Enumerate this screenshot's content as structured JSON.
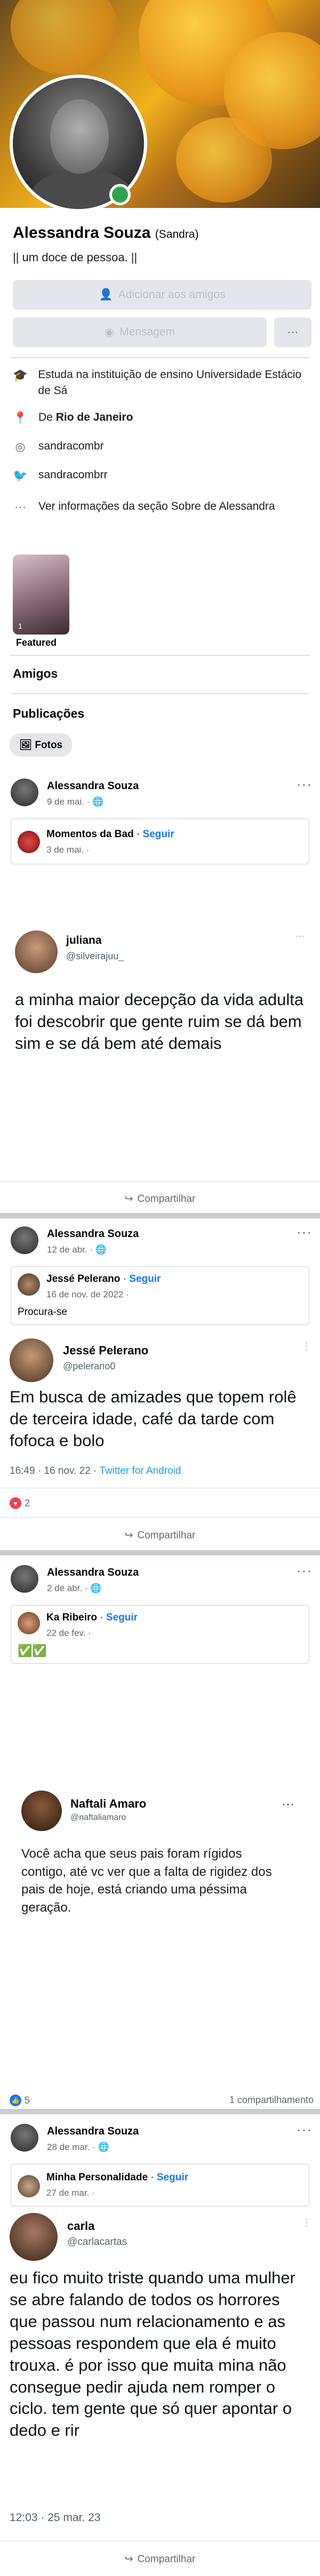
{
  "profile": {
    "name": "Alessandra Souza",
    "nickname": "(Sandra)",
    "bio": "|| um doce de pessoa. ||",
    "add_friend_label": "Adicionar aos amigos",
    "message_label": "Mensagem",
    "more_label": "···",
    "online_color": "#31a24c"
  },
  "info": {
    "study_prefix": "Estuda na instituição de ensino ",
    "study_place": "Universidade Estácio de Sá",
    "from_prefix": "De ",
    "from_place": "Rio de Janeiro",
    "instagram": "sandracombr",
    "twitter": "sandracombrr",
    "see_more": "Ver informações da seção Sobre de Alessandra"
  },
  "featured": {
    "label": "Featured",
    "count": "1"
  },
  "sections": {
    "friends": "Amigos",
    "posts": "Publicações",
    "photos_chip": "Fotos"
  },
  "posts": [
    {
      "author": "Alessandra Souza",
      "date": "9 de mai. ·",
      "shared_from": "Momentos da Bad",
      "shared_date": "3 de mai. ·",
      "follow": "Seguir",
      "tweet": {
        "name": "juliana",
        "handle": "@silveirajuu_",
        "text": "a minha maior decepção da vida adulta foi descobrir que gente ruim se dá bem sim e se dá bem até demais"
      },
      "share_label": "Compartilhar"
    },
    {
      "author": "Alessandra Souza",
      "date": "12 de abr. ·",
      "shared_from": "Jessé Pelerano",
      "shared_date": "16 de nov. de 2022 ·",
      "follow": "Seguir",
      "shared_caption": "Procura-se",
      "tweet": {
        "name": "Jessé Pelerano",
        "handle": "@pelerano0",
        "text": "Em busca de amizades que topem rolê de terceira idade, café da tarde com fofoca e bolo",
        "time": "16:49 · 16 nov. 22 · ",
        "client": "Twitter for Android"
      },
      "reactions": "2",
      "share_label": "Compartilhar"
    },
    {
      "author": "Alessandra Souza",
      "date": "2 de abr. ·",
      "shared_from": "Ka Ribeiro",
      "shared_date": "22 de fev. ·",
      "follow": "Seguir",
      "shared_caption": "✅✅",
      "tweet": {
        "name": "Naftali Amaro",
        "handle": "@naftaliamaro",
        "text": "Você acha que seus pais foram rígidos contigo, até vc ver que a falta de rigidez dos pais de hoje, está criando uma péssima geração."
      },
      "reactions": "5",
      "shares": "1 compartilhamento"
    },
    {
      "author": "Alessandra Souza",
      "date": "28 de mar. ·",
      "shared_from": "Minha Personalidade",
      "shared_date": "27 de mar. ·",
      "follow": "Seguir",
      "tweet": {
        "name": "carla",
        "handle": "@carlacartas",
        "text": "eu fico muito triste quando uma mulher se abre falando de todos os horrores que passou num relacionamento e as pessoas respondem que ela é muito trouxa. é por isso que muita mina não consegue pedir ajuda nem romper o ciclo. tem gente que só quer apontar o dedo e rir",
        "time": "12:03 · 25 mar. 23"
      },
      "share_label": "Compartilhar"
    }
  ],
  "colors": {
    "accent": "#1877f2",
    "twitter_blue": "#1d9bf0",
    "reaction_red": "#f33e58",
    "reaction_blue": "#1877f2"
  }
}
